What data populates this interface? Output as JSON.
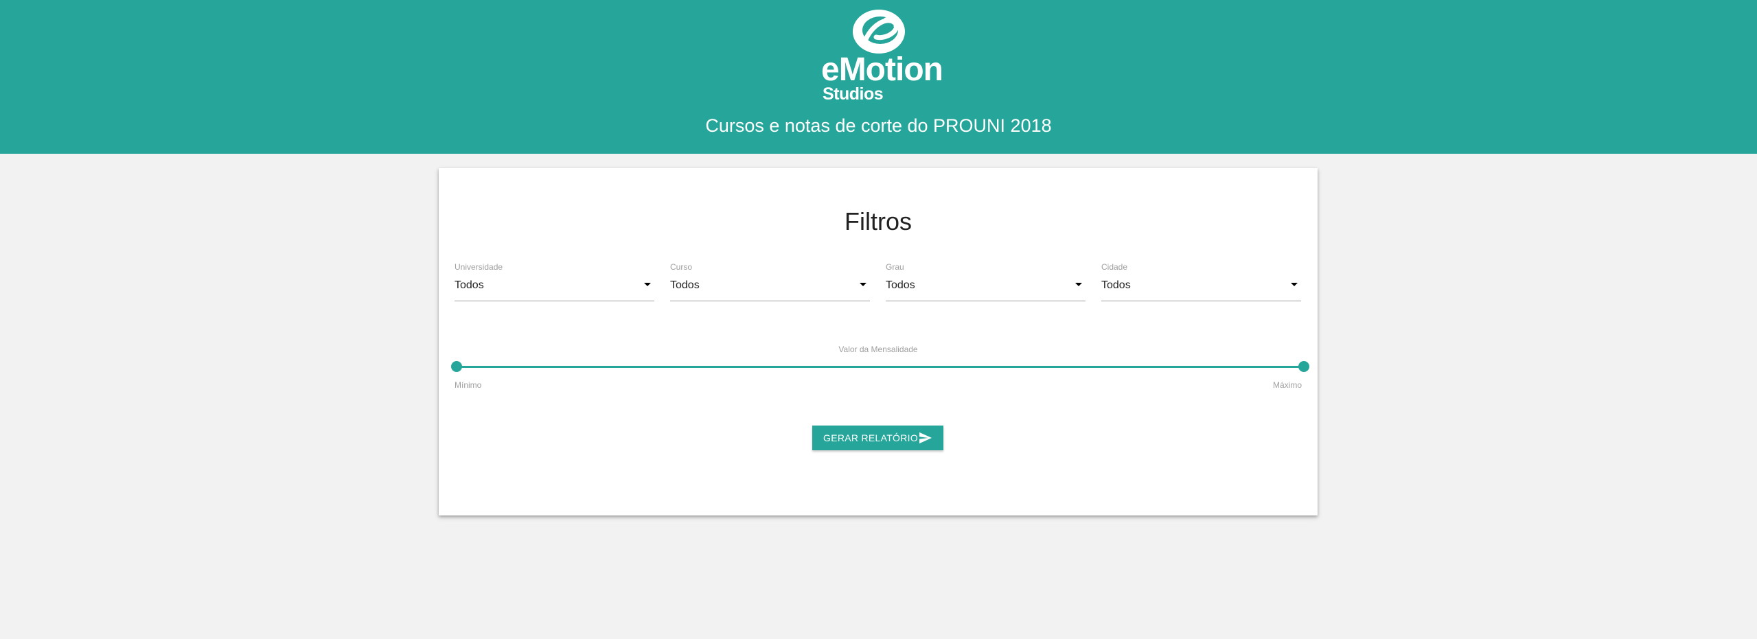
{
  "header": {
    "logo": {
      "word": "eMotion",
      "sub": "Studios"
    },
    "title": "Cursos e notas de corte do PROUNI 2018"
  },
  "filters": {
    "title": "Filtros",
    "selects": [
      {
        "label": "Universidade",
        "value": "Todos"
      },
      {
        "label": "Curso",
        "value": "Todos"
      },
      {
        "label": "Grau",
        "value": "Todos"
      },
      {
        "label": "Cidade",
        "value": "Todos"
      }
    ],
    "slider": {
      "label": "Valor da Mensalidade",
      "min_label": "Mínimo",
      "max_label": "Máximo",
      "lower_fraction": 0,
      "upper_fraction": 1
    },
    "submit": {
      "label": "GERAR RELATÓRIO",
      "icon": "send-icon"
    }
  },
  "colors": {
    "accent": "#26a69a",
    "background": "#f2f2f2",
    "card": "#ffffff"
  }
}
